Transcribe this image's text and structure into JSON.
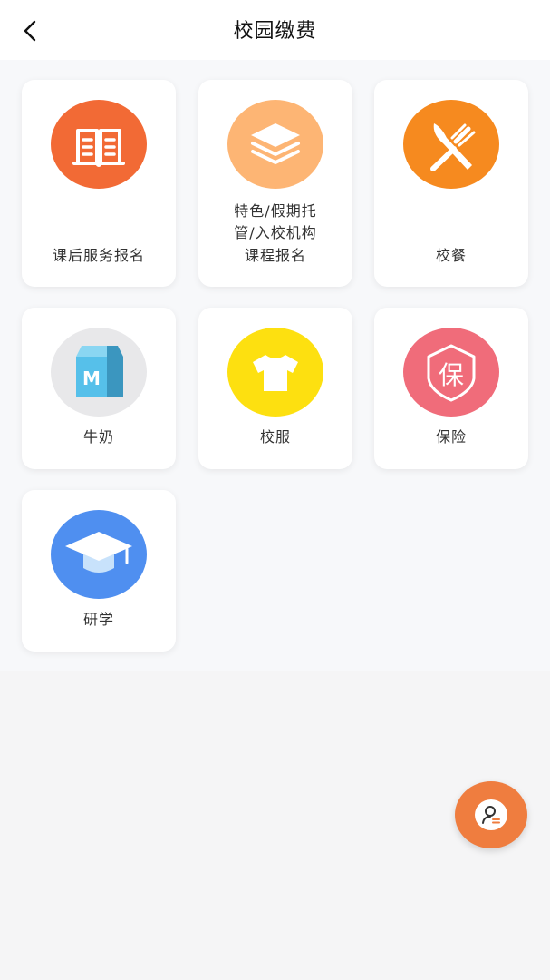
{
  "header": {
    "title": "校园缴费",
    "back_icon": "chevron-left-icon"
  },
  "services": [
    {
      "label_lines": [
        "课后服务报名"
      ],
      "icon": "book-icon",
      "color": "#f26a35"
    },
    {
      "label_lines": [
        "特色/假期托",
        "管/入校机构",
        "课程报名"
      ],
      "icon": "layers-icon",
      "color": "#fdb574"
    },
    {
      "label_lines": [
        "校餐"
      ],
      "icon": "cutlery-icon",
      "color": "#f68a1f"
    },
    {
      "label_lines": [
        "牛奶"
      ],
      "icon": "milk-carton-icon",
      "color": "#e8e8ea"
    },
    {
      "label_lines": [
        "校服"
      ],
      "icon": "tshirt-icon",
      "color": "#fde010"
    },
    {
      "label_lines": [
        "保险"
      ],
      "icon": "insurance-shield-icon",
      "color": "#f06c7a"
    },
    {
      "label_lines": [
        "研学"
      ],
      "icon": "graduation-cap-icon",
      "color": "#4f8ff0"
    }
  ],
  "fab": {
    "icon": "user-service-icon",
    "color": "#ef7d3f"
  }
}
